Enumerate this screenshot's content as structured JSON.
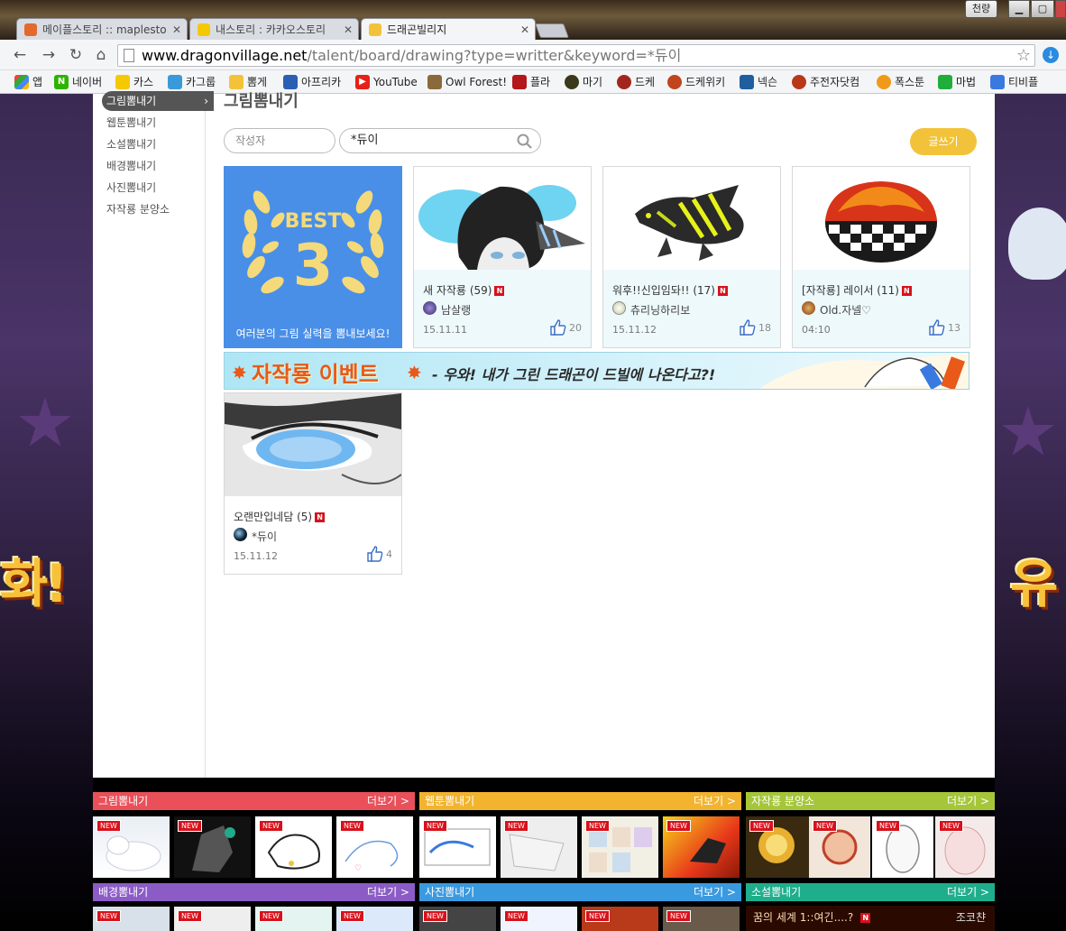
{
  "browser": {
    "tabs": [
      {
        "label": "메이플스토리 :: maplesto",
        "favicon_color": "#e36a2e"
      },
      {
        "label": "내스토리 : 카카오스토리",
        "favicon_color": "#f5c800"
      },
      {
        "label": "드래곤빌리지",
        "favicon_color": "#f2c33a"
      }
    ],
    "user_badge": "천량",
    "url_host": "www.dragonvillage.net",
    "url_path": "/talent/board/drawing?type=writter&keyword=*듀이",
    "bookmarks": [
      {
        "label": "앱",
        "color": "#e44"
      },
      {
        "label": "네이버",
        "color": "#2db400",
        "glyph": "N"
      },
      {
        "label": "카스",
        "color": "#f5c800"
      },
      {
        "label": "카그룹",
        "color": "#3a9ad9"
      },
      {
        "label": "뽐게",
        "color": "#f2c33a"
      },
      {
        "label": "아프리카",
        "color": "#2a5fb3"
      },
      {
        "label": "YouTube",
        "color": "#e62117"
      },
      {
        "label": "Owl Forest!",
        "color": "#8a6a3a"
      },
      {
        "label": "플라",
        "color": "#b3171b"
      },
      {
        "label": "마기",
        "color": "#3a3a1a"
      },
      {
        "label": "드케",
        "color": "#a3261d"
      },
      {
        "label": "드케위키",
        "color": "#c0441c"
      },
      {
        "label": "넥슨",
        "color": "#1f5f9f"
      },
      {
        "label": "주전자닷컴",
        "color": "#b8391a"
      },
      {
        "label": "폭스툰",
        "color": "#f09a1a"
      },
      {
        "label": "마법",
        "color": "#1fae3c"
      },
      {
        "label": "티비플",
        "color": "#3a7ae0"
      }
    ]
  },
  "sidebar": {
    "items": [
      {
        "label": "그림뽐내기",
        "active": true
      },
      {
        "label": "웹툰뽐내기"
      },
      {
        "label": "소설뽐내기"
      },
      {
        "label": "배경뽐내기"
      },
      {
        "label": "사진뽐내기"
      },
      {
        "label": "자작룡 분양소"
      }
    ]
  },
  "main": {
    "title": "그림뽐내기",
    "search": {
      "author_placeholder": "작성자",
      "keyword": "*듀이"
    },
    "write_button": "글쓰기",
    "best": {
      "label": "BEST",
      "number": "3",
      "caption": "여러분의 그림 실력을 뽐내보세요!"
    },
    "cards": [
      {
        "title": "새 자작룡",
        "count": "(59)",
        "badge": "N",
        "author": "남살랭",
        "date": "15.11.11",
        "likes": "20"
      },
      {
        "title": "워후!!신입임돠!!",
        "count": "(17)",
        "badge": "N",
        "author": "츄리닝하리보",
        "date": "15.11.12",
        "likes": "18"
      },
      {
        "title": "[자작룡] 레이서",
        "count": "(11)",
        "badge": "N",
        "author": "Old.자넬♡",
        "date": "04:10",
        "likes": "13"
      },
      {
        "title": "오랜만입네담",
        "count": "(5)",
        "badge": "N",
        "author": "*듀이",
        "date": "15.11.12",
        "likes": "4"
      }
    ],
    "banner": {
      "title": "자작룡 이벤트",
      "subtitle": "- 우와! 내가 그린 드래곤이 드빌에 나온다고?!"
    }
  },
  "footer": {
    "more_label": "더보기 >",
    "new_tag": "NEW",
    "sections_top": [
      {
        "label": "그림뽐내기",
        "color": "#e9505a"
      },
      {
        "label": "웹툰뽐내기",
        "color": "#f2b32e"
      },
      {
        "label": "자작룡 분양소",
        "color": "#a6c63a"
      }
    ],
    "sections_bottom": [
      {
        "label": "배경뽐내기",
        "color": "#8b5cc6"
      },
      {
        "label": "사진뽐내기",
        "color": "#3a9ae0"
      },
      {
        "label": "소설뽐내기",
        "color": "#1fae8c"
      }
    ],
    "novel": {
      "title": "꿈의 세계 1::여긴....?",
      "author": "조코챤"
    }
  }
}
